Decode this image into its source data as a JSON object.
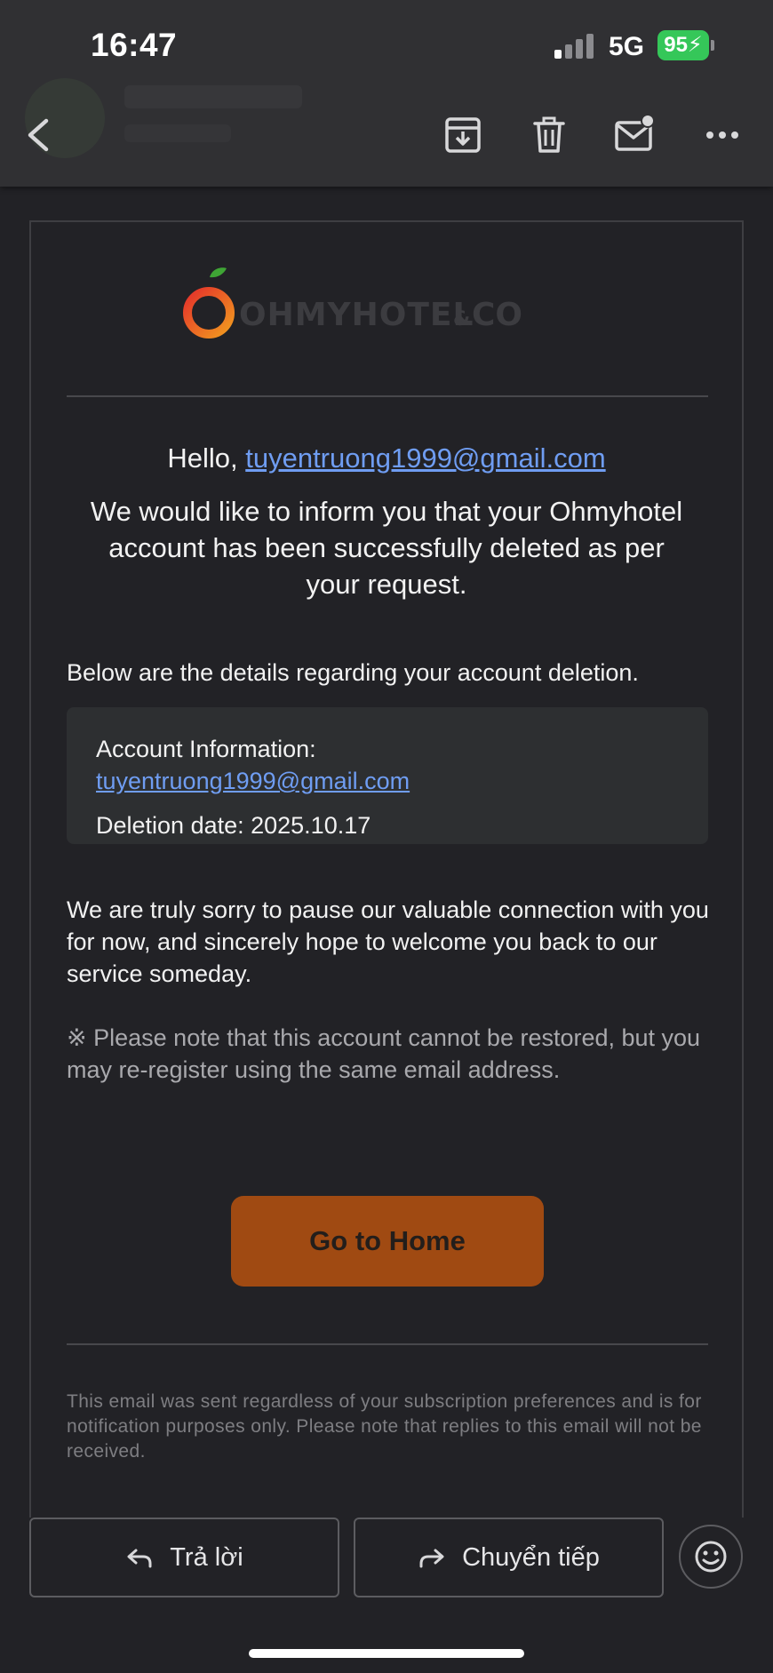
{
  "status_bar": {
    "time": "16:47",
    "network": "5G",
    "battery": "95",
    "battery_color": "#35c759"
  },
  "toolbar": {
    "icons": [
      "back-icon",
      "archive-icon",
      "trash-icon",
      "mark-unread-icon",
      "more-icon"
    ]
  },
  "email": {
    "logo_text": "OHMYHOTEL&CO",
    "greeting_prefix": "Hello,",
    "greeting_email": "tuyentruong1999@gmail.com",
    "intro": "We would like to inform you that your Ohmyhotel account has been successfully deleted as per your request.",
    "details_intro": "Below are the details regarding your account deletion.",
    "account_label": "Account Information:",
    "account_email": "tuyentruong1999@gmail.com",
    "deletion_date": "Deletion date: 2025.10.17",
    "sorry_text": "We are truly sorry to pause our valuable connection with you for now, and sincerely hope to welcome you back to our service someday.",
    "note_text": "※ Please note that this account cannot be restored, but you may re-register using the same email address.",
    "home_button": "Go to Home",
    "footer_note": "This email was sent regardless of your subscription preferences and is for notification purposes only. Please note that replies to this email will not be received.",
    "link_color": "#6f9df2",
    "button_color": "#a04a12"
  },
  "bottom_bar": {
    "reply_label": "Trả lời",
    "forward_label": "Chuyển tiếp",
    "emoji_icon": "emoji-icon"
  }
}
